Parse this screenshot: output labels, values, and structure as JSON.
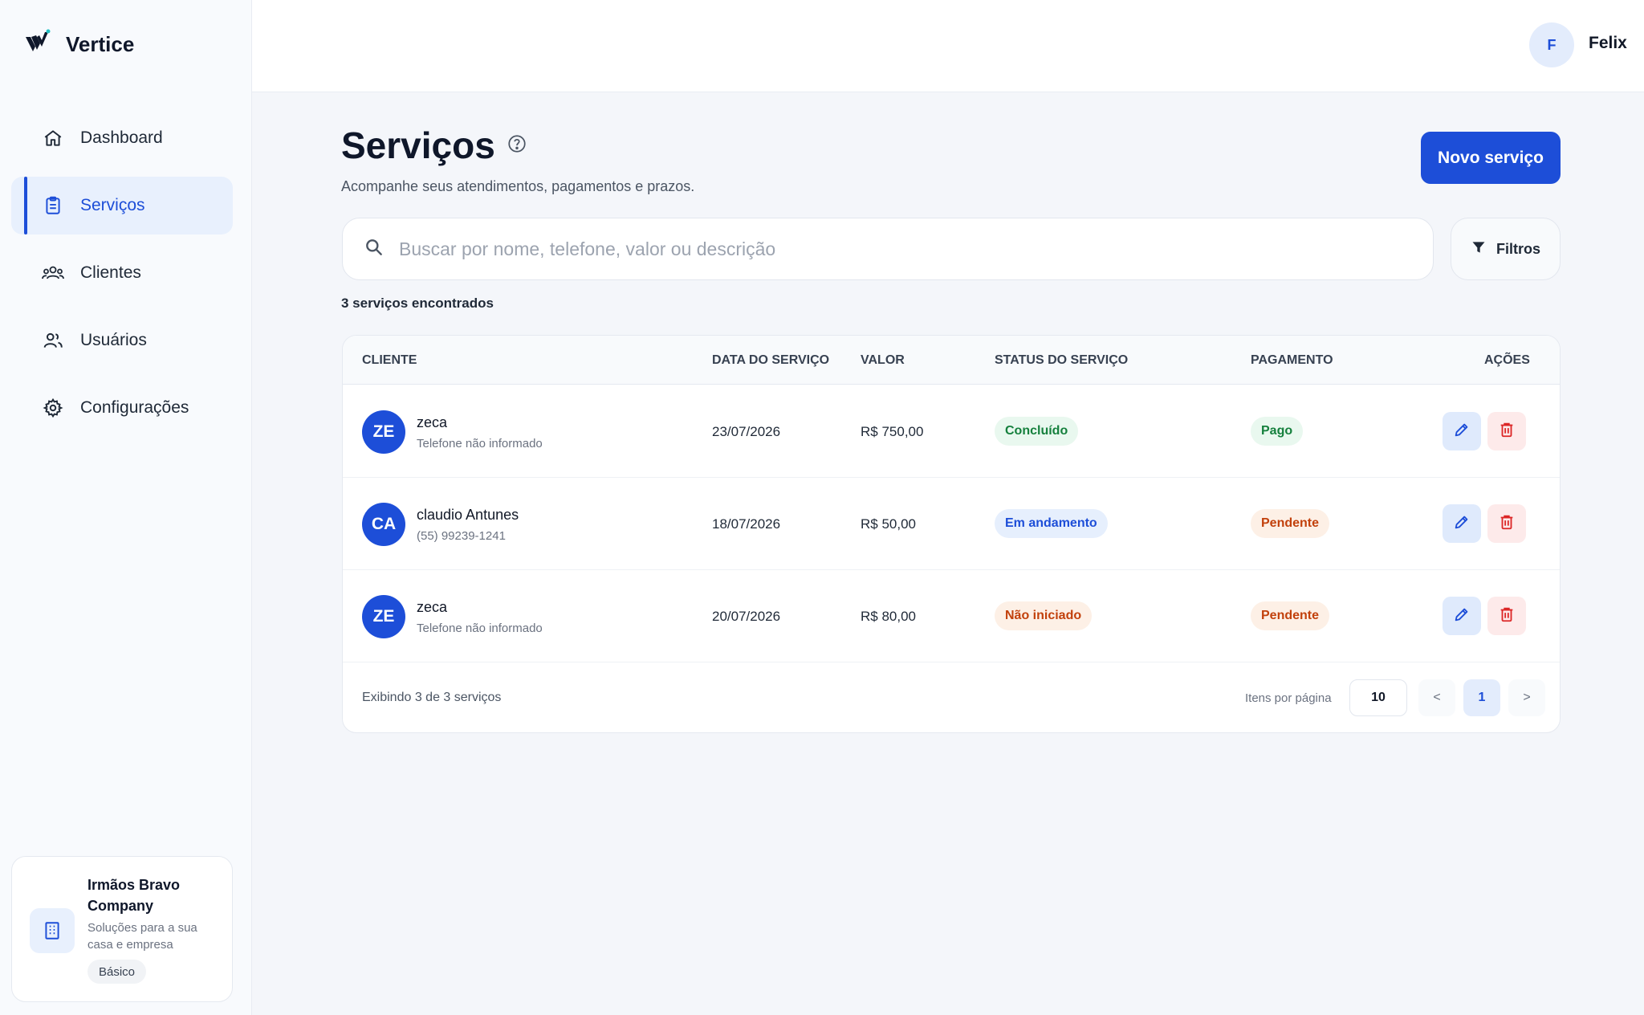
{
  "brand": {
    "name": "Vertice"
  },
  "sidebar": {
    "items": [
      {
        "label": "Dashboard",
        "icon": "home-icon"
      },
      {
        "label": "Serviços",
        "icon": "clipboard-icon",
        "active": true
      },
      {
        "label": "Clientes",
        "icon": "users-group-icon"
      },
      {
        "label": "Usuários",
        "icon": "user-group-icon"
      },
      {
        "label": "Configurações",
        "icon": "gear-icon"
      }
    ]
  },
  "company": {
    "name": "Irmãos Bravo Company",
    "description": "Soluções para a sua casa e empresa",
    "plan": "Básico",
    "icon": "building-icon"
  },
  "user": {
    "initial": "F",
    "name": "Felix"
  },
  "page": {
    "title": "Serviços",
    "subtitle": "Acompanhe seus atendimentos, pagamentos e prazos.",
    "new_button": "Novo serviço",
    "search_placeholder": "Buscar por nome, telefone, valor ou descrição",
    "search_value": "",
    "filters_label": "Filtros",
    "result_count": "3 serviços encontrados"
  },
  "table": {
    "headers": {
      "client": "CLIENTE",
      "date": "DATA DO SERVIÇO",
      "value": "VALOR",
      "status": "STATUS DO SERVIÇO",
      "payment": "PAGAMENTO",
      "actions": "AÇÕES"
    },
    "rows": [
      {
        "initials": "ZE",
        "name": "zeca",
        "phone": "Telefone não informado",
        "date": "23/07/2026",
        "value": "R$ 750,00",
        "status": "Concluído",
        "status_tone": "green",
        "payment": "Pago",
        "payment_tone": "green"
      },
      {
        "initials": "CA",
        "name": "claudio Antunes",
        "phone": "(55) 99239-1241",
        "date": "18/07/2026",
        "value": "R$ 50,00",
        "status": "Em andamento",
        "status_tone": "blue",
        "payment": "Pendente",
        "payment_tone": "orange"
      },
      {
        "initials": "ZE",
        "name": "zeca",
        "phone": "Telefone não informado",
        "date": "20/07/2026",
        "value": "R$ 80,00",
        "status": "Não iniciado",
        "status_tone": "orange",
        "payment": "Pendente",
        "payment_tone": "orange"
      }
    ],
    "footer": {
      "showing": "Exibindo 3 de 3 serviços",
      "per_page_label": "Itens por página",
      "per_page": "10",
      "prev": "<",
      "current_page": "1",
      "next": ">"
    }
  },
  "colors": {
    "accent": "#1d4ed8",
    "success": "#15803d",
    "warning": "#c2410c",
    "danger": "#dc2626"
  }
}
